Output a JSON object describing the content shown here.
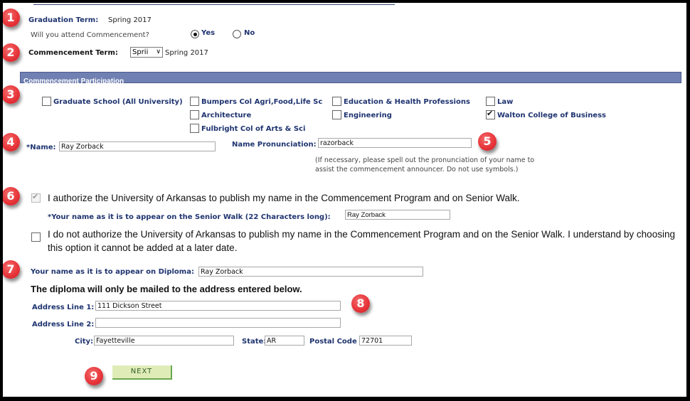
{
  "graduation": {
    "label": "Graduation Term:",
    "value": "Spring 2017",
    "attend_question": "Will you attend Commencement?",
    "attend_options": [
      {
        "label": "Yes",
        "selected": true
      },
      {
        "label": "No",
        "selected": false
      }
    ]
  },
  "commencement": {
    "label": "Commencement Term:",
    "select_value": "Sprii",
    "term_text": "Spring 2017"
  },
  "section": {
    "title": "Commencement Participation"
  },
  "colleges": [
    {
      "label": "Graduate School (All University)",
      "checked": false
    },
    {
      "label": "Bumpers Col Agri,Food,Life Sc",
      "checked": false
    },
    {
      "label": "Architecture",
      "checked": false
    },
    {
      "label": "Fulbright Col of Arts & Sci",
      "checked": false
    },
    {
      "label": "Education & Health Professions",
      "checked": false
    },
    {
      "label": "Engineering",
      "checked": false
    },
    {
      "label": "Law",
      "checked": false
    },
    {
      "label": "Walton College of Business",
      "checked": true
    }
  ],
  "name": {
    "label": "*Name:",
    "value": "Ray Zorback"
  },
  "pronunciation": {
    "label": "Name Pronunciation:",
    "value": "razorback",
    "help_line1": "(If necessary, please spell out the pronunciation of your name to",
    "help_line2": "assist the commencement announcer. Do not use symbols.)"
  },
  "authorize": {
    "checked": true,
    "text": "I authorize the University of Arkansas to publish my name in the Commencement Program and on Senior Walk.",
    "senior_walk_label": "*Your name as it is to appear on the Senior Walk (22 Characters long):",
    "senior_walk_value": "Ray Zorback"
  },
  "not_authorize": {
    "checked": false,
    "text_line1": "I do not authorize the University of Arkansas to publish my name in the Commencement Program and on the Senior Walk. I understand by choosing",
    "text_line2": "this option it cannot be added at a later date."
  },
  "diploma": {
    "label": "Your name as it is to appear on Diploma:",
    "value": "Ray Zorback",
    "notice": "The diploma will only be mailed to the address entered below."
  },
  "address": {
    "line1_label": "Address Line 1:",
    "line1_value": "111 Dickson Street",
    "line2_label": "Address Line 2:",
    "line2_value": "",
    "city_label": "City:",
    "city_value": "Fayetteville",
    "state_label": "State:",
    "state_value": "AR",
    "postal_label": "Postal Code",
    "postal_value": "72701"
  },
  "next_button": "NEXT",
  "badges": [
    "1",
    "2",
    "3",
    "4",
    "5",
    "6",
    "7",
    "8",
    "9"
  ],
  "colors": {
    "label_blue": "#1f3470",
    "section_bar": "#7080b2",
    "badge_red": "#e8363b",
    "next_bg": "#e0ecb8",
    "next_border": "#6aa84f"
  }
}
